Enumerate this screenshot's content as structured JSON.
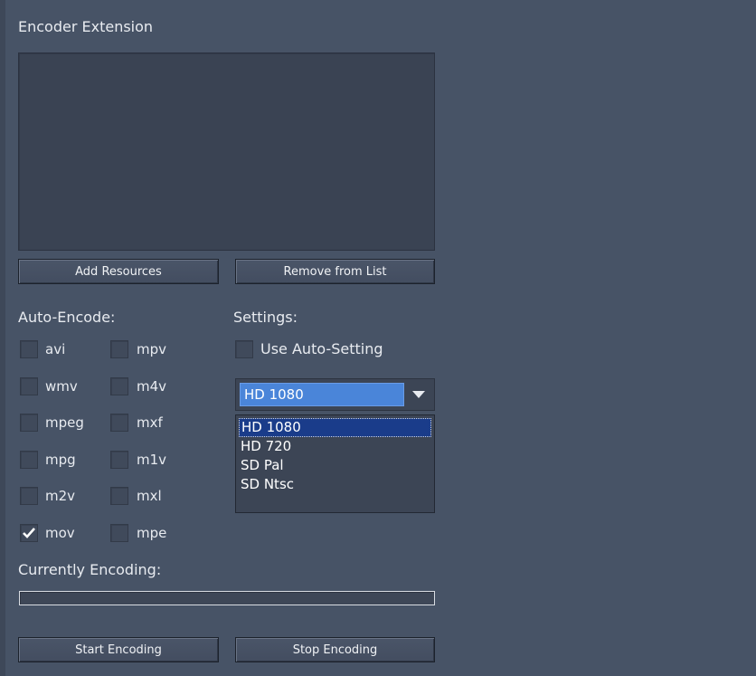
{
  "title": "Encoder Extension",
  "buttons": {
    "add_resources": "Add Resources",
    "remove_from_list": "Remove from List",
    "start_encoding": "Start Encoding",
    "stop_encoding": "Stop Encoding"
  },
  "auto_encode": {
    "label": "Auto-Encode:",
    "formats": [
      {
        "label": "avi",
        "checked": false
      },
      {
        "label": "wmv",
        "checked": false
      },
      {
        "label": "mpeg",
        "checked": false
      },
      {
        "label": "mpg",
        "checked": false
      },
      {
        "label": "m2v",
        "checked": false
      },
      {
        "label": "mov",
        "checked": true
      },
      {
        "label": "mpv",
        "checked": false
      },
      {
        "label": "m4v",
        "checked": false
      },
      {
        "label": "mxf",
        "checked": false
      },
      {
        "label": "m1v",
        "checked": false
      },
      {
        "label": "mxl",
        "checked": false
      },
      {
        "label": "mpe",
        "checked": false
      }
    ]
  },
  "settings": {
    "label": "Settings:",
    "use_auto_setting_label": "Use Auto-Setting",
    "use_auto_setting_checked": false,
    "preset_selected": "HD 1080",
    "preset_options": [
      "HD 1080",
      "HD 720",
      "SD Pal",
      "SD Ntsc"
    ]
  },
  "encoding": {
    "label": "Currently Encoding:",
    "progress": 0
  },
  "icons": {
    "check": "checkmark-icon",
    "dropdown": "triangle-down-icon"
  },
  "colors": {
    "background": "#475366",
    "selection": "#4a85d9",
    "dropdown_highlight": "#1a3c8a"
  }
}
